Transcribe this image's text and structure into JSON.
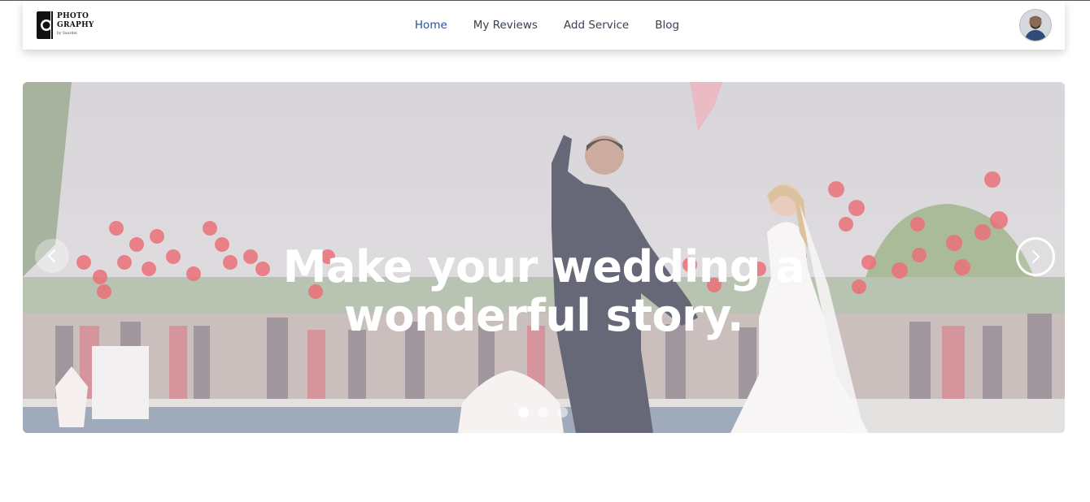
{
  "brand": {
    "line1": "PHOTO",
    "line2": "GRAPHY",
    "tagline": "by Saurdel"
  },
  "nav": {
    "items": [
      {
        "label": "Home",
        "active": true
      },
      {
        "label": "My Reviews",
        "active": false
      },
      {
        "label": "Add Service",
        "active": false
      },
      {
        "label": "Blog",
        "active": false
      }
    ],
    "active_color": "#2d4f9e",
    "text_color": "#374151"
  },
  "hero": {
    "title_line1": "Make your wedding a",
    "title_line2": "wonderful story.",
    "slide_count": 3,
    "active_slide": 1,
    "prev_icon": "chevron-left-icon",
    "next_icon": "chevron-right-icon"
  },
  "colors": {
    "balloon": "#e43a45",
    "background": "#ffffff"
  }
}
